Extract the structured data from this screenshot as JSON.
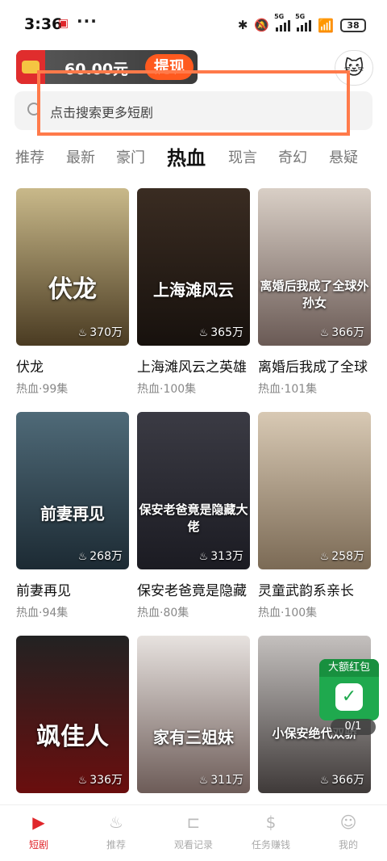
{
  "status": {
    "time": "3:36",
    "dots": "···",
    "battery": "38",
    "sig1": "5G",
    "sig2": "5G"
  },
  "header": {
    "coin_amount": "60.00元",
    "withdraw_label": "提现"
  },
  "search": {
    "placeholder": "点击搜索更多短剧"
  },
  "tabs": [
    "推荐",
    "最新",
    "豪门",
    "热血",
    "现言",
    "奇幻",
    "悬疑"
  ],
  "dramas": [
    {
      "title": "伏龙",
      "genre": "热血",
      "episodes": "99集",
      "views": "370万",
      "poster_text": "伏龙",
      "color_top": "#c9b98a",
      "color_bottom": "#4a3b22"
    },
    {
      "title": "上海滩风云之英雄",
      "genre": "热血",
      "episodes": "100集",
      "views": "365万",
      "poster_text": "上海滩风云",
      "color_top": "#3a2c22",
      "color_bottom": "#17110d"
    },
    {
      "title": "离婚后我成了全球",
      "genre": "热血",
      "episodes": "101集",
      "views": "366万",
      "poster_text": "离婚后我成了全球外孙女",
      "color_top": "#d9cfc6",
      "color_bottom": "#6a5a55"
    },
    {
      "title": "前妻再见",
      "genre": "热血",
      "episodes": "94集",
      "views": "268万",
      "poster_text": "前妻再见",
      "color_top": "#4f6a78",
      "color_bottom": "#1c2a33"
    },
    {
      "title": "保安老爸竟是隐藏",
      "genre": "热血",
      "episodes": "80集",
      "views": "313万",
      "poster_text": "保安老爸竟是隐藏大佬",
      "color_top": "#3b3b44",
      "color_bottom": "#1b1b22"
    },
    {
      "title": "灵童武韵系亲长",
      "genre": "热血",
      "episodes": "100集",
      "views": "258万",
      "poster_text": "",
      "color_top": "#d8c9b4",
      "color_bottom": "#7b6a55"
    },
    {
      "title": "",
      "genre": "",
      "episodes": "",
      "views": "336万",
      "poster_text": "飒佳人",
      "color_top": "#222222",
      "color_bottom": "#6a0e0e"
    },
    {
      "title": "",
      "genre": "",
      "episodes": "",
      "views": "311万",
      "poster_text": "家有三姐妹",
      "color_top": "#e7e2df",
      "color_bottom": "#6d5c58"
    },
    {
      "title": "",
      "genre": "",
      "episodes": "",
      "views": "366万",
      "poster_text": "小保安绝代双骄",
      "color_top": "#c4c0be",
      "color_bottom": "#3f3a39"
    }
  ],
  "red_packet": {
    "label": "大额红包",
    "progress": "0/1"
  },
  "nav": [
    "短剧",
    "推荐",
    "观看记录",
    "任务赚钱",
    "我的"
  ],
  "colors": {
    "accent": "#e0262b",
    "withdraw": "#ff5a1f",
    "highlight": "#ff7a4a"
  }
}
